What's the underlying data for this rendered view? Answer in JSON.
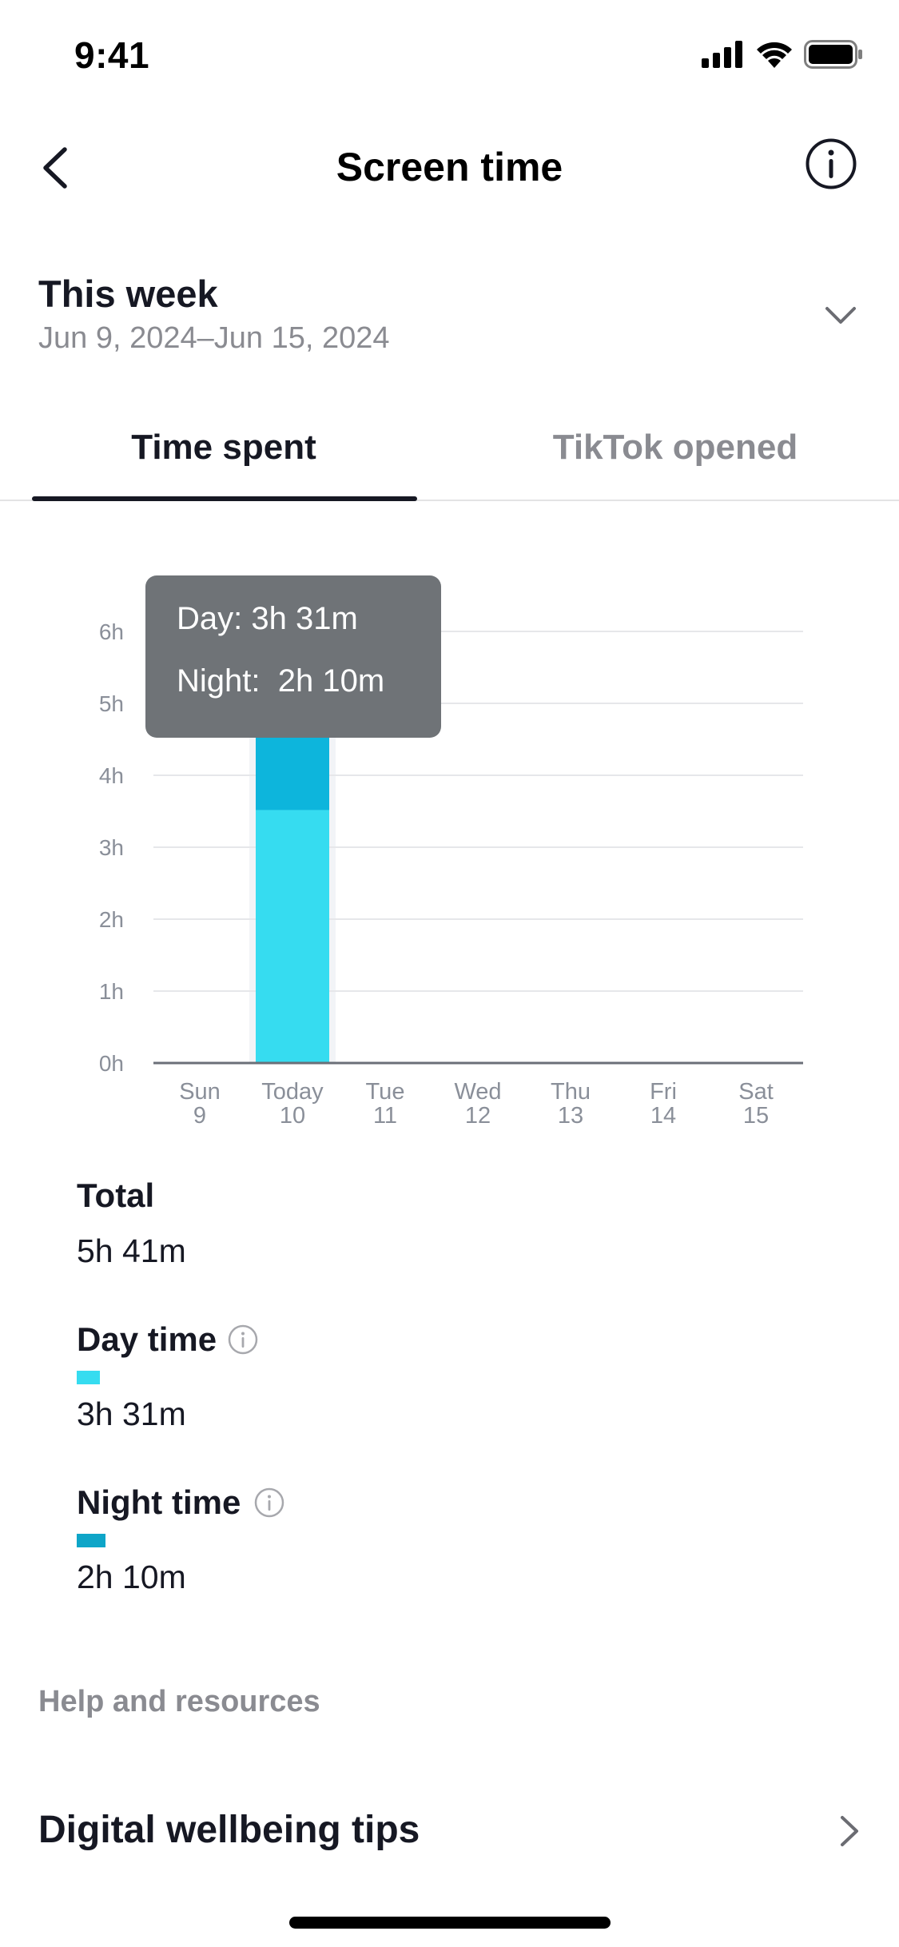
{
  "status_bar": {
    "time": "9:41"
  },
  "header": {
    "title": "Screen time"
  },
  "week": {
    "title": "This week",
    "range": "Jun 9, 2024–Jun 15, 2024"
  },
  "tabs": [
    {
      "label": "Time spent",
      "selected": true
    },
    {
      "label": "TikTok opened",
      "selected": false
    }
  ],
  "tooltip": {
    "day_label": "Day:",
    "day_value": "3h 31m",
    "night_label": "Night:",
    "night_value": "2h 10m"
  },
  "chart_data": {
    "type": "bar",
    "stacked": true,
    "categories": [
      {
        "day": "Sun",
        "date": "9"
      },
      {
        "day": "Today",
        "date": "10"
      },
      {
        "day": "Tue",
        "date": "11"
      },
      {
        "day": "Wed",
        "date": "12"
      },
      {
        "day": "Thu",
        "date": "13"
      },
      {
        "day": "Fri",
        "date": "14"
      },
      {
        "day": "Sat",
        "date": "15"
      }
    ],
    "series": [
      {
        "name": "Day time",
        "color": "#36dcf0",
        "values": [
          0,
          3.517,
          0,
          0,
          0,
          0,
          0
        ]
      },
      {
        "name": "Night time",
        "color": "#0db5dc",
        "values": [
          0,
          2.167,
          0,
          0,
          0,
          0,
          0
        ]
      }
    ],
    "y_ticks": [
      "0h",
      "1h",
      "2h",
      "3h",
      "4h",
      "5h",
      "6h"
    ],
    "ylim": [
      0,
      6
    ],
    "highlighted_index": 1,
    "grid": true
  },
  "summary": {
    "total_label": "Total",
    "total_value": "5h 41m",
    "day_label": "Day time",
    "day_value": "3h 31m",
    "day_color": "#36dcf0",
    "night_label": "Night time",
    "night_value": "2h 10m",
    "night_color": "#0ea5c8"
  },
  "help": {
    "label": "Help and resources"
  },
  "tips": {
    "label": "Digital wellbeing tips"
  }
}
